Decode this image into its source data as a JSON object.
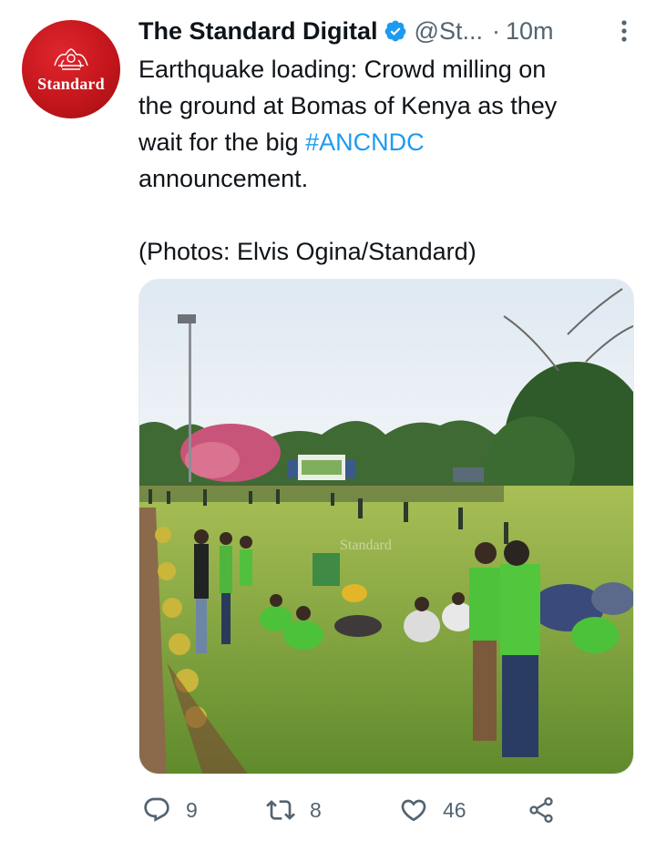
{
  "avatar": {
    "brand_text": "Standard",
    "color": "#c4161c"
  },
  "header": {
    "display_name": "The Standard Digital",
    "handle": "@St...",
    "separator": "·",
    "time": "10m",
    "verified_color": "#1d9bf0"
  },
  "tweet": {
    "line1": "Earthquake loading: Crowd milling on",
    "line2": "the ground at Bomas of Kenya as they",
    "line3_prefix": "wait for the big ",
    "hashtag": "#ANCNDC",
    "line4": "announcement.",
    "credit": "(Photos: Elvis Ogina/Standard)"
  },
  "media": {
    "watermark": "Standard"
  },
  "actions": {
    "reply_count": "9",
    "retweet_count": "8",
    "like_count": "46"
  },
  "colors": {
    "accent": "#1d9bf0",
    "secondary_text": "#536471",
    "primary_text": "#0f1419"
  }
}
